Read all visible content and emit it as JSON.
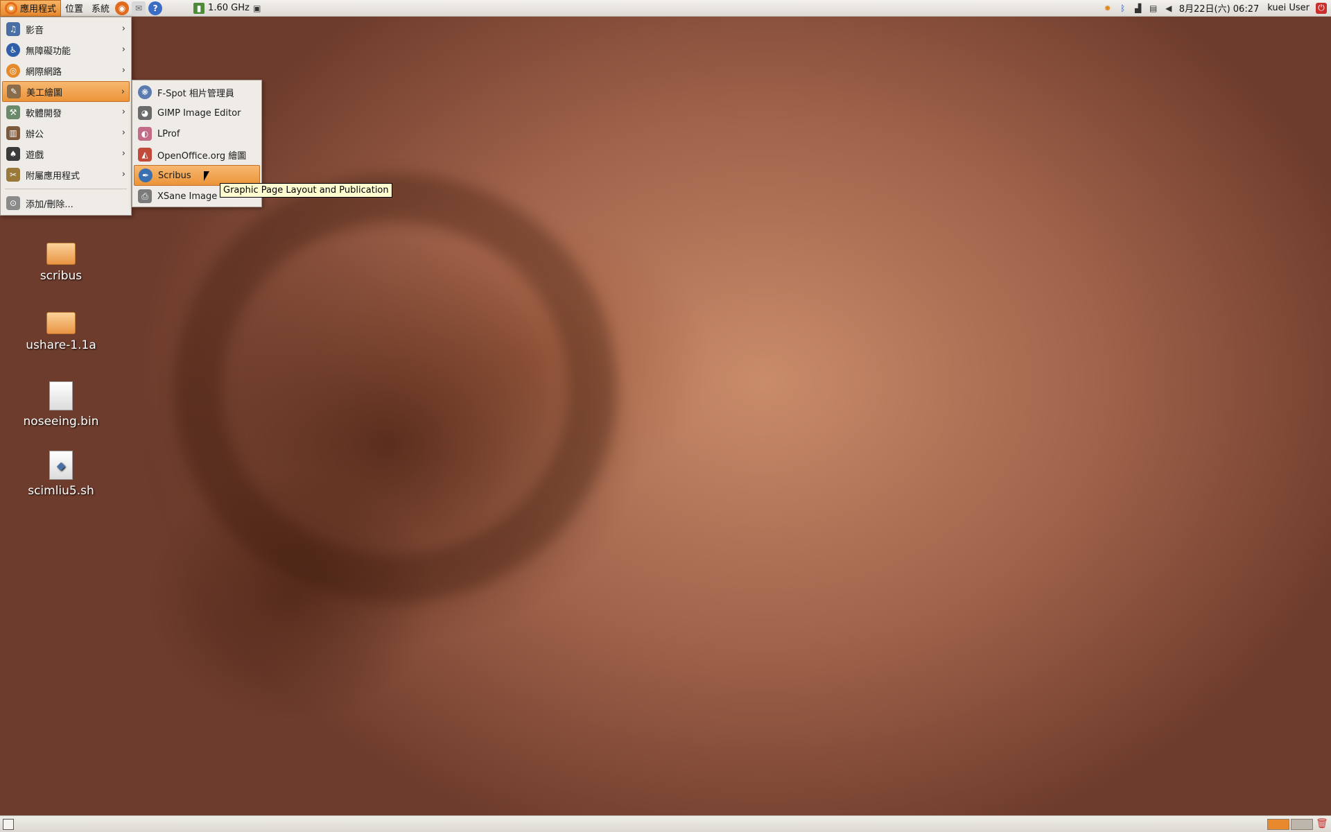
{
  "top_panel": {
    "applications": "應用程式",
    "places": "位置",
    "system": "系統",
    "cpu_freq": "1.60 GHz",
    "datetime": "8月22日(六) 06:27",
    "user": "kuei User"
  },
  "apps_menu": {
    "items": [
      {
        "label": "影音",
        "icon": "multimedia-icon",
        "color": "#4a6fa5"
      },
      {
        "label": "無障礙功能",
        "icon": "accessibility-icon",
        "color": "#2f5fa8"
      },
      {
        "label": "網際網路",
        "icon": "internet-icon",
        "color": "#e48a2b"
      },
      {
        "label": "美工繪圖",
        "icon": "graphics-icon",
        "color": "#8a6b4a"
      },
      {
        "label": "軟體開發",
        "icon": "development-icon",
        "color": "#6b8a6b"
      },
      {
        "label": "辦公",
        "icon": "office-icon",
        "color": "#7d5a3c"
      },
      {
        "label": "遊戲",
        "icon": "games-icon",
        "color": "#3b3b3b"
      },
      {
        "label": "附屬應用程式",
        "icon": "accessories-icon",
        "color": "#9a7a3a"
      }
    ],
    "add_remove": "添加/刪除..."
  },
  "graphics_submenu": {
    "items": [
      {
        "label": "F-Spot 相片管理員",
        "icon": "fspot-icon",
        "color": "#5a7ab0"
      },
      {
        "label": "GIMP Image Editor",
        "icon": "gimp-icon",
        "color": "#6a6a6a"
      },
      {
        "label": "LProf",
        "icon": "lprof-icon",
        "color": "#c46b8a"
      },
      {
        "label": "OpenOffice.org 繪圖",
        "icon": "openoffice-draw-icon",
        "color": "#c24a3a"
      },
      {
        "label": "Scribus",
        "icon": "scribus-icon",
        "color": "#3a6fb0"
      },
      {
        "label": "XSane Image",
        "icon": "xsane-icon",
        "color": "#7a7a7a"
      }
    ]
  },
  "tooltip": "Graphic Page Layout and Publication",
  "desktop_icons": [
    {
      "label": "scribus",
      "type": "folder"
    },
    {
      "label": "ushare-1.1a",
      "type": "folder"
    },
    {
      "label": "noseeing.bin",
      "type": "file"
    },
    {
      "label": "scimliu5.sh",
      "type": "script"
    }
  ]
}
